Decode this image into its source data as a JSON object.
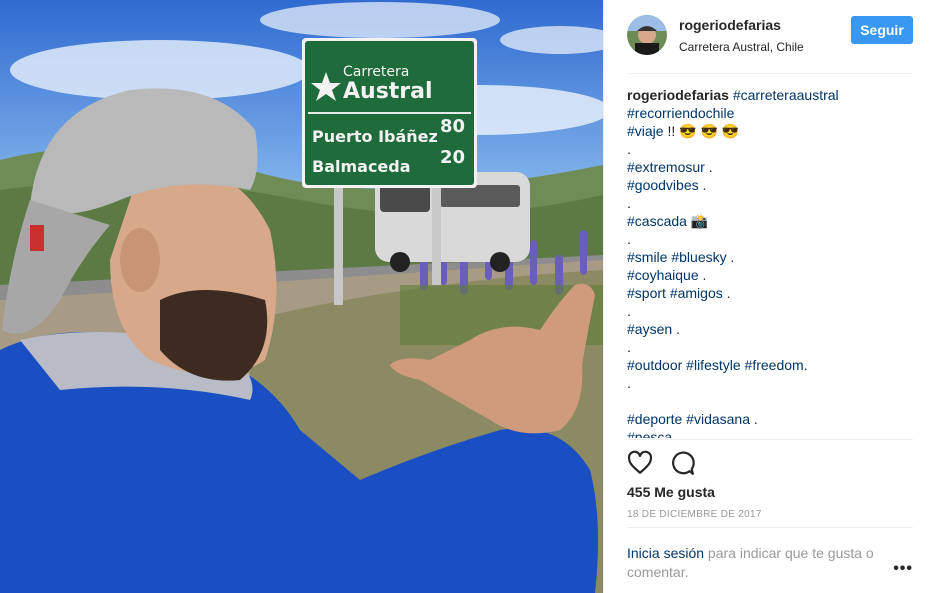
{
  "post": {
    "username": "rogeriodefarias",
    "location": "Carretera Austral, Chile",
    "follow_label": "Seguir",
    "caption_user": "rogeriodefarias",
    "caption_lines": [
      [
        {
          "t": "rogeriodefarias",
          "k": "user"
        },
        {
          "t": " "
        },
        {
          "t": "#carreteraaustral",
          "k": "tag"
        }
      ],
      [
        {
          "t": "#recorriendochile",
          "k": "tag"
        }
      ],
      [
        {
          "t": "#viaje",
          "k": "tag"
        },
        {
          "t": " !! 😎 😎 😎"
        }
      ],
      [
        {
          "t": "."
        }
      ],
      [
        {
          "t": "#extremosur",
          "k": "tag"
        },
        {
          "t": " ."
        }
      ],
      [
        {
          "t": "#goodvibes",
          "k": "tag"
        },
        {
          "t": " ."
        }
      ],
      [
        {
          "t": "."
        }
      ],
      [
        {
          "t": "#cascada",
          "k": "tag"
        },
        {
          "t": " 📸"
        }
      ],
      [
        {
          "t": "."
        }
      ],
      [
        {
          "t": "#smile",
          "k": "tag"
        },
        {
          "t": " "
        },
        {
          "t": "#bluesky",
          "k": "tag"
        },
        {
          "t": " ."
        }
      ],
      [
        {
          "t": "#coyhaique",
          "k": "tag"
        },
        {
          "t": " ."
        }
      ],
      [
        {
          "t": "#sport",
          "k": "tag"
        },
        {
          "t": " "
        },
        {
          "t": "#amigos",
          "k": "tag"
        },
        {
          "t": " ."
        }
      ],
      [
        {
          "t": "."
        }
      ],
      [
        {
          "t": "#aysen",
          "k": "tag"
        },
        {
          "t": " ."
        }
      ],
      [
        {
          "t": "."
        }
      ],
      [
        {
          "t": "#outdoor",
          "k": "tag"
        },
        {
          "t": " "
        },
        {
          "t": "#lifestyle",
          "k": "tag"
        },
        {
          "t": " "
        },
        {
          "t": "#freedom",
          "k": "tag"
        },
        {
          "t": "."
        }
      ],
      [
        {
          "t": "."
        }
      ],
      [
        {
          "t": ""
        }
      ],
      [
        {
          "t": "#deporte",
          "k": "tag"
        },
        {
          "t": " "
        },
        {
          "t": "#vidasana",
          "k": "tag"
        },
        {
          "t": " ."
        }
      ],
      [
        {
          "t": "#pesca",
          "k": "tag"
        }
      ]
    ],
    "likes": "455 Me gusta",
    "date": "18 DE DICIEMBRE DE 2017",
    "login_link": "Inicia sesión",
    "login_text": " para indicar que te gusta o comentar.",
    "more": "•••"
  },
  "photo": {
    "sign_title": "Carretera",
    "sign_name": "Austral",
    "rows": [
      {
        "place": "Puerto Ibáñez",
        "km": "80"
      },
      {
        "place": "Balmaceda",
        "km": "20"
      }
    ]
  },
  "colors": {
    "follow_bg": "#3897f0",
    "link": "#003569",
    "sign_green": "#1f6b3b",
    "hoodie_blue": "#1a4fc4"
  },
  "icons": [
    "heart-icon",
    "comment-icon",
    "more-options-icon"
  ]
}
